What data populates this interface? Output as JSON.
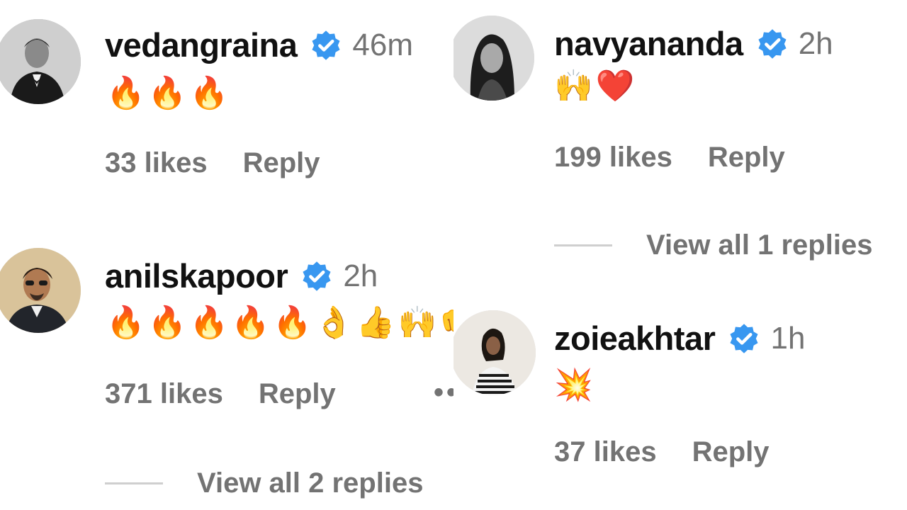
{
  "comments": [
    {
      "username": "vedangraina",
      "time": "46m",
      "emoji": "🔥🔥🔥",
      "likes": "33 likes",
      "reply": "Reply"
    },
    {
      "username": "anilskapoor",
      "time": "2h",
      "emoji": "🔥🔥🔥🔥🔥👌👍🙌👊",
      "likes": "371 likes",
      "reply": "Reply",
      "more": "••",
      "view_replies": "View all 2 replies"
    },
    {
      "username": "navyananda",
      "time": "2h",
      "emoji": "🙌❤️",
      "likes": "199 likes",
      "reply": "Reply",
      "view_replies": "View all 1 replies"
    },
    {
      "username": "zoieakhtar",
      "time": "1h",
      "emoji": "💥",
      "likes": "37 likes",
      "reply": "Reply"
    }
  ],
  "colors": {
    "verified_badge": "#3897f0",
    "secondary_text": "#737373",
    "primary_text": "#111111"
  }
}
